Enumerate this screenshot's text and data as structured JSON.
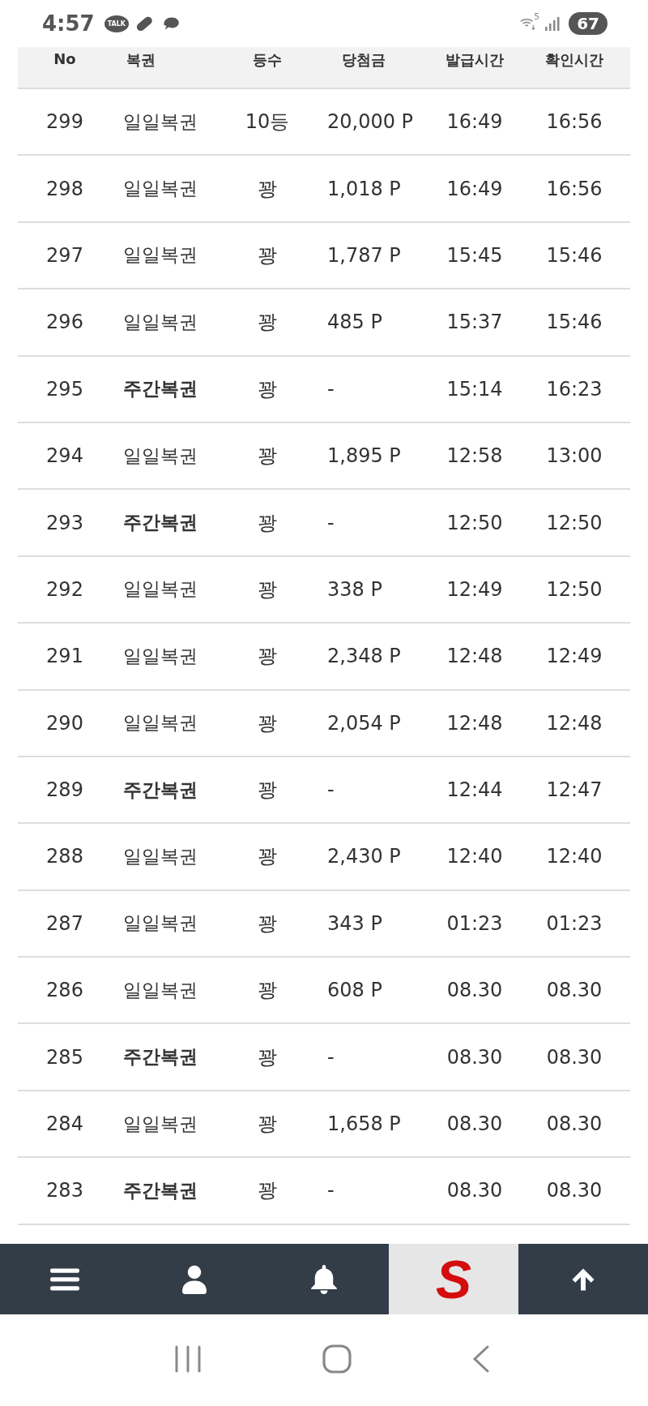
{
  "status_bar": {
    "time": "4:57",
    "talk_badge": "TALK",
    "wifi_label": "5",
    "battery": "67"
  },
  "table": {
    "columns": [
      "No",
      "복권",
      "등수",
      "당첨금",
      "발급시간",
      "확인시간"
    ],
    "rows": [
      {
        "no": "299",
        "lottery": "일일복권",
        "kind": "daily",
        "rank": "10등",
        "prize": "20,000 P",
        "issued": "16:49",
        "checked": "16:56"
      },
      {
        "no": "298",
        "lottery": "일일복권",
        "kind": "daily",
        "rank": "꽝",
        "prize": "1,018 P",
        "issued": "16:49",
        "checked": "16:56"
      },
      {
        "no": "297",
        "lottery": "일일복권",
        "kind": "daily",
        "rank": "꽝",
        "prize": "1,787 P",
        "issued": "15:45",
        "checked": "15:46"
      },
      {
        "no": "296",
        "lottery": "일일복권",
        "kind": "daily",
        "rank": "꽝",
        "prize": "485 P",
        "issued": "15:37",
        "checked": "15:46"
      },
      {
        "no": "295",
        "lottery": "주간복권",
        "kind": "weekly",
        "rank": "꽝",
        "prize": "-",
        "issued": "15:14",
        "checked": "16:23"
      },
      {
        "no": "294",
        "lottery": "일일복권",
        "kind": "daily",
        "rank": "꽝",
        "prize": "1,895 P",
        "issued": "12:58",
        "checked": "13:00"
      },
      {
        "no": "293",
        "lottery": "주간복권",
        "kind": "weekly",
        "rank": "꽝",
        "prize": "-",
        "issued": "12:50",
        "checked": "12:50"
      },
      {
        "no": "292",
        "lottery": "일일복권",
        "kind": "daily",
        "rank": "꽝",
        "prize": "338 P",
        "issued": "12:49",
        "checked": "12:50"
      },
      {
        "no": "291",
        "lottery": "일일복권",
        "kind": "daily",
        "rank": "꽝",
        "prize": "2,348 P",
        "issued": "12:48",
        "checked": "12:49"
      },
      {
        "no": "290",
        "lottery": "일일복권",
        "kind": "daily",
        "rank": "꽝",
        "prize": "2,054 P",
        "issued": "12:48",
        "checked": "12:48"
      },
      {
        "no": "289",
        "lottery": "주간복권",
        "kind": "weekly",
        "rank": "꽝",
        "prize": "-",
        "issued": "12:44",
        "checked": "12:47"
      },
      {
        "no": "288",
        "lottery": "일일복권",
        "kind": "daily",
        "rank": "꽝",
        "prize": "2,430 P",
        "issued": "12:40",
        "checked": "12:40"
      },
      {
        "no": "287",
        "lottery": "일일복권",
        "kind": "daily",
        "rank": "꽝",
        "prize": "343 P",
        "issued": "01:23",
        "checked": "01:23"
      },
      {
        "no": "286",
        "lottery": "일일복권",
        "kind": "daily",
        "rank": "꽝",
        "prize": "608 P",
        "issued": "08.30",
        "checked": "08.30"
      },
      {
        "no": "285",
        "lottery": "주간복권",
        "kind": "weekly",
        "rank": "꽝",
        "prize": "-",
        "issued": "08.30",
        "checked": "08.30"
      },
      {
        "no": "284",
        "lottery": "일일복권",
        "kind": "daily",
        "rank": "꽝",
        "prize": "1,658 P",
        "issued": "08.30",
        "checked": "08.30"
      },
      {
        "no": "283",
        "lottery": "주간복권",
        "kind": "weekly",
        "rank": "꽝",
        "prize": "-",
        "issued": "08.30",
        "checked": "08.30"
      }
    ]
  },
  "bottom_nav": [
    {
      "kind": "menu",
      "selected": false
    },
    {
      "kind": "user",
      "selected": false
    },
    {
      "kind": "bell",
      "selected": false
    },
    {
      "kind": "logo",
      "label": "S",
      "selected": true
    },
    {
      "kind": "up",
      "selected": false
    }
  ]
}
